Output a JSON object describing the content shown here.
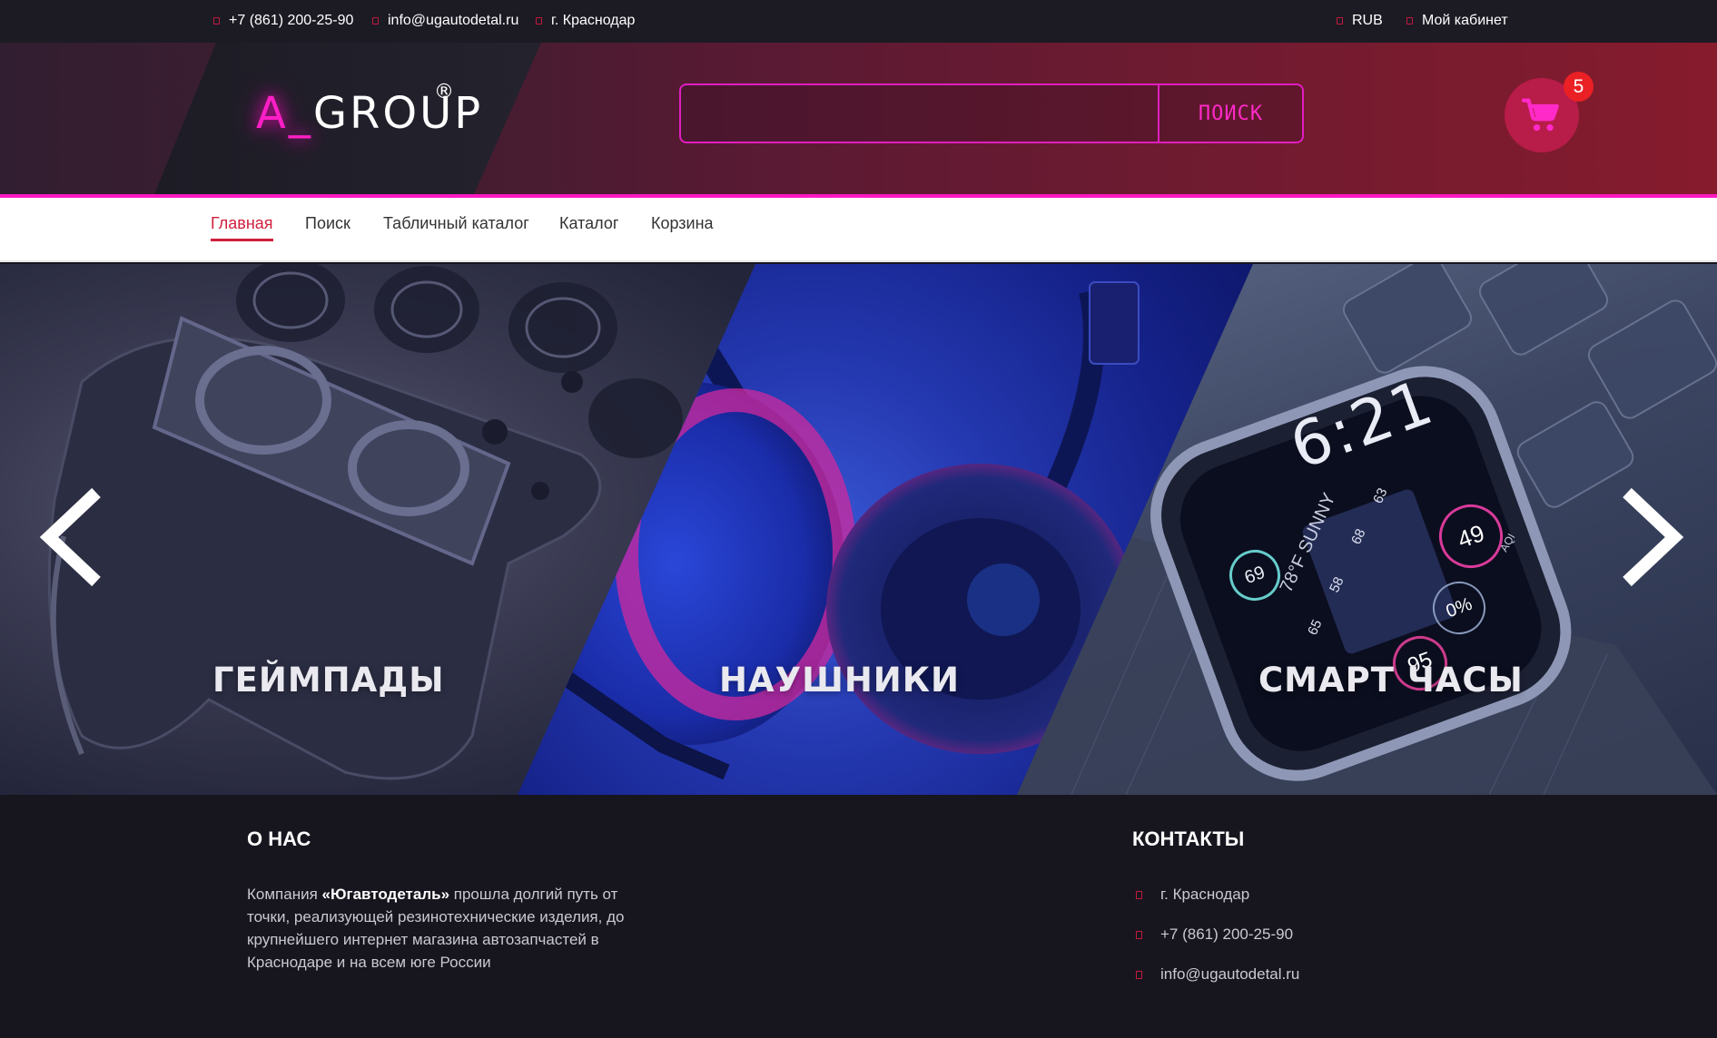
{
  "topbar": {
    "phone": "+7 (861) 200-25-90",
    "email": "info@ugautodetal.ru",
    "city": "г. Краснодар",
    "currency": "RUB",
    "account": "Мой кабинет"
  },
  "header": {
    "logo_prefix": "A_",
    "logo_text": "GROUP",
    "logo_reg": "®",
    "search_placeholder": "",
    "search_button": "ПОИСК",
    "cart_count": "5",
    "cart_icon": "shopping-cart-icon"
  },
  "nav": {
    "items": [
      {
        "label": "Главная",
        "active": true
      },
      {
        "label": "Поиск"
      },
      {
        "label": "Табличный каталог"
      },
      {
        "label": "Каталог"
      },
      {
        "label": "Корзина"
      }
    ]
  },
  "banner": {
    "slides": [
      {
        "title": "ГЕЙМПАДЫ"
      },
      {
        "title": "НАУШНИКИ"
      },
      {
        "title": "СМАРТ ЧАСЫ"
      }
    ],
    "prev_icon": "chevron-left-icon",
    "next_icon": "chevron-right-icon",
    "watch_time": "6:21",
    "watch_weather": "78°F SUNNY",
    "watch_left": "69",
    "watch_right": "49",
    "watch_right_sub": "AQI",
    "watch_pct": "0%",
    "watch_bottom": "95",
    "watch_temps": [
      "63",
      "68",
      "58",
      "65"
    ]
  },
  "footer": {
    "about_title": "О НАС",
    "about_pre": "Компания ",
    "about_company": "«Югавтодеталь»",
    "about_post": " прошла долгий путь от точки, реализующей резинотехнические изделия, до крупнейшего интернет магазина автозапчастей в Краснодаре и на всем юге России",
    "contacts_title": "КОНТАКТЫ",
    "contacts": {
      "city": "г. Краснодар",
      "phone": "+7 (861) 200-25-90",
      "email": "info@ugautodetal.ru"
    }
  },
  "colors": {
    "accent_magenta": "#ff19c2",
    "accent_red": "#cf1f3c",
    "cart_bg": "#b81c49",
    "badge_red": "#ea2024",
    "footer_bg": "#17161f"
  }
}
